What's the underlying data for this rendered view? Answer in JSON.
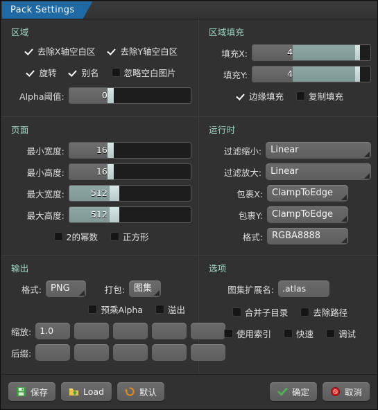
{
  "window": {
    "tab_title": "Pack Settings"
  },
  "groups": {
    "region": {
      "title": "区域",
      "strip_x_label": "去除X轴空白区",
      "strip_y_label": "去除Y轴空白区",
      "rotation_label": "旋转",
      "alias_label": "别名",
      "ignore_blank_label": "忽略空白图片",
      "alpha_threshold_label": "Alpha阈值:",
      "alpha_threshold_value": "0"
    },
    "region_padding": {
      "title": "区域填充",
      "pad_x_label": "填充X:",
      "pad_x_value": "4",
      "pad_y_label": "填充Y:",
      "pad_y_value": "4",
      "edge_padding_label": "边缘填充",
      "duplicate_padding_label": "复制填充"
    },
    "page": {
      "title": "页面",
      "min_width_label": "最小宽度:",
      "min_width_value": "16",
      "min_height_label": "最小高度:",
      "min_height_value": "16",
      "max_width_label": "最大宽度:",
      "max_width_value": "512",
      "max_height_label": "最大高度:",
      "max_height_value": "512",
      "pot_label": "2的幂数",
      "square_label": "正方形"
    },
    "runtime": {
      "title": "运行时",
      "filter_min_label": "过滤缩小:",
      "filter_min_value": "Linear",
      "filter_mag_label": "过滤放大:",
      "filter_mag_value": "Linear",
      "wrap_x_label": "包裹X:",
      "wrap_x_value": "ClampToEdge",
      "wrap_y_label": "包裹Y:",
      "wrap_y_value": "ClampToEdge",
      "format_label": "格式:",
      "format_value": "RGBA8888"
    },
    "output": {
      "title": "输出",
      "format_label": "格式:",
      "format_value": "PNG",
      "pack_label": "打包:",
      "pack_value": "图集",
      "premultiply_alpha_label": "预乘Alpha",
      "bleed_label": "溢出",
      "scale_label": "缩放:",
      "scale_values": [
        "1.0",
        "",
        "",
        "",
        ""
      ],
      "suffix_label": "后缀:",
      "suffix_values": [
        "",
        "",
        "",
        "",
        ""
      ]
    },
    "options": {
      "title": "选项",
      "atlas_extension_label": "图集扩展名:",
      "atlas_extension_value": ".atlas",
      "combine_subdirs_label": "合并子目录",
      "flatten_paths_label": "去除路径",
      "use_indexes_label": "使用索引",
      "fast_label": "快速",
      "debug_label": "调试"
    }
  },
  "footer": {
    "save_label": "保存",
    "load_label": "Load",
    "default_label": "默认",
    "ok_label": "确定",
    "cancel_label": "取消"
  },
  "colors": {
    "tab_active": "#1f6aa5",
    "group_title": "#9fd8c8",
    "slider_handle": "#d8e7e7",
    "slider_fill_teal": "#8ea6a4",
    "panel_bg": "#313131"
  }
}
